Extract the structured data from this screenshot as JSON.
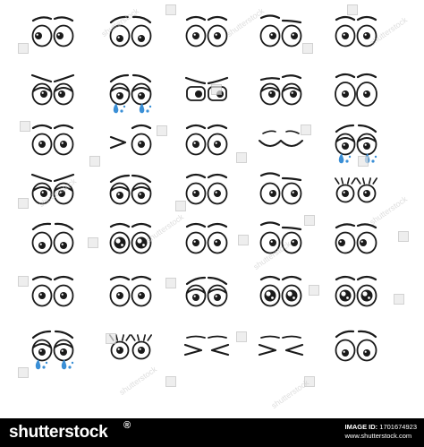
{
  "footer": {
    "brand": "shutterstock",
    "brand_mark": "®",
    "image_id_label": "IMAGE ID:",
    "image_id": "1701674923",
    "site": "www.shutterstock.com"
  },
  "watermark": {
    "text": "shutterstock"
  },
  "expressions": [
    [
      "side-glance",
      "worried",
      "neutral",
      "skeptical",
      "neutral"
    ],
    [
      "angry",
      "crying",
      "suspicious",
      "annoyed",
      "wide"
    ],
    [
      "neutral",
      "wink",
      "neutral",
      "closed-happy",
      "crying"
    ],
    [
      "angry",
      "sad",
      "neutral",
      "skeptical",
      "eyelashes"
    ],
    [
      "worried",
      "sparkle",
      "neutral",
      "skeptical",
      "side-glance"
    ],
    [
      "neutral",
      "neutral",
      "sad",
      "sparkle",
      "sparkle"
    ],
    [
      "crying",
      "eyelashes",
      "squint",
      "squint",
      "worried"
    ]
  ],
  "palette": {
    "line": "#1a1a1a",
    "tear": "#3a8fd6"
  }
}
